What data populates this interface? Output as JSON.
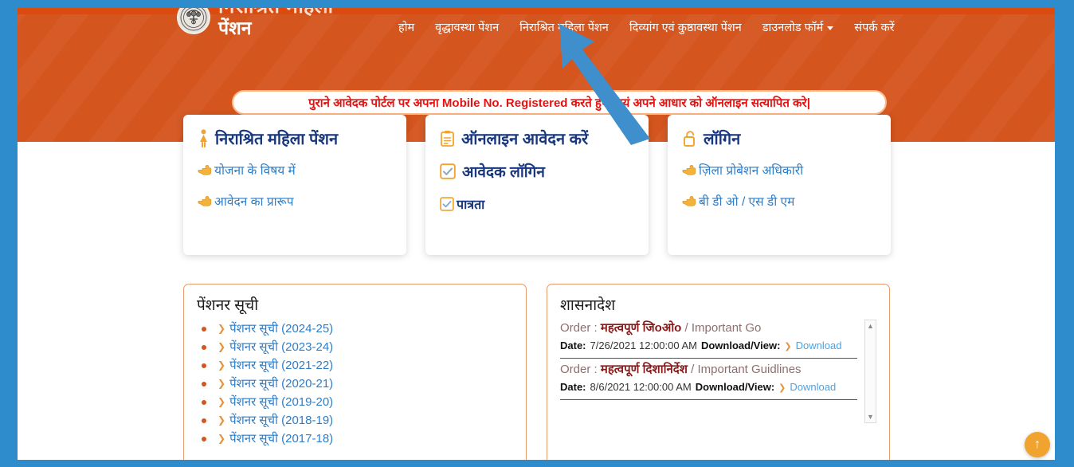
{
  "theme": {
    "orange": "#D4551E",
    "orange_top": "#DC4A0E",
    "frame_blue": "#2E8BCC",
    "link_blue": "#2E7DC6",
    "title_navy": "#18377E",
    "notice_red": "#E8110F",
    "accent_yellow": "#F0A32E",
    "panel_border": "#E79A6B"
  },
  "header": {
    "brand_line1": "निराश्रित महिला",
    "brand_line2": "पेंशन",
    "emblem_icon": "ashoka-emblem-icon",
    "nav": [
      {
        "label": "होम",
        "has_caret": false
      },
      {
        "label": "वृद्धावस्था पेंशन",
        "has_caret": false
      },
      {
        "label": "निराश्रित महिला पेंशन",
        "has_caret": false
      },
      {
        "label": "दिव्यांग एवं कुष्ठावस्था पेंशन",
        "has_caret": false
      },
      {
        "label": "डाउनलोड फॉर्म",
        "has_caret": true
      },
      {
        "label": "संपर्क करें",
        "has_caret": false
      }
    ]
  },
  "notice": {
    "text": "पुराने आवेदक पोर्टल पर अपना Mobile No. Registered करते हुए स्वयं अपने आधार को ऑनलाइन सत्यापित करे|"
  },
  "cards": [
    {
      "title": "निराश्रित महिला पेंशन",
      "title_icon": "woman-figure-icon",
      "links": [
        {
          "label": "योजना के विषय में",
          "icon": "pointing-hand-icon",
          "style": "normal"
        },
        {
          "label": "आवेदन का प्रारूप",
          "icon": "pointing-hand-icon",
          "style": "normal"
        }
      ]
    },
    {
      "title": "ऑनलाइन आवेदन करें",
      "title_icon": "clipboard-form-icon",
      "links": [
        {
          "label": "आवेदक लॉगिन",
          "icon": "checkbox-checked-icon",
          "style": "big"
        },
        {
          "label": "पात्रता",
          "icon": "checkbox-checked-icon",
          "style": "med"
        }
      ]
    },
    {
      "title": "लॉगिन",
      "title_icon": "unlock-padlock-icon",
      "links": [
        {
          "label": "ज़िला प्रोबेशन अधिकारी",
          "icon": "pointing-hand-icon",
          "style": "normal"
        },
        {
          "label": "बी डी ओ / एस डी एम",
          "icon": "pointing-hand-icon",
          "style": "normal"
        }
      ]
    }
  ],
  "pensioner_panel": {
    "title": "पेंशनर सूची",
    "items": [
      {
        "label": "पेंशनर सूची (2024-25)"
      },
      {
        "label": "पेंशनर सूची (2023-24)"
      },
      {
        "label": "पेंशनर सूची (2021-22)"
      },
      {
        "label": "पेंशनर सूची (2020-21)"
      },
      {
        "label": "पेंशनर सूची (2019-20)"
      },
      {
        "label": "पेंशनर सूची (2018-19)"
      },
      {
        "label": "पेंशनर सूची (2017-18)"
      }
    ]
  },
  "orders_panel": {
    "title": "शासनादेश",
    "order_label": "Order :",
    "date_label": "Date:",
    "download_label": "Download/View:",
    "download_link_text": "Download",
    "orders": [
      {
        "name_hi": "महत्वपूर्ण जिоओo",
        "separator": "/",
        "name_en": "Important Go",
        "date": "7/26/2021 12:00:00 AM"
      },
      {
        "name_hi": "महत्वपूर्ण दिशानिर्देश",
        "separator": "/",
        "name_en": "Important Guidlines",
        "date": "8/6/2021 12:00:00 AM"
      }
    ],
    "scroll_up_icon": "scroll-up-arrow-icon",
    "scroll_down_icon": "scroll-down-arrow-icon"
  },
  "fab": {
    "icon": "scroll-to-top-arrow-icon",
    "glyph": "↑"
  },
  "annotation": {
    "arrow_icon": "blue-pointer-arrow-icon",
    "points_to": "निराश्रित महिला पेंशन",
    "color": "#3E8FCB"
  }
}
